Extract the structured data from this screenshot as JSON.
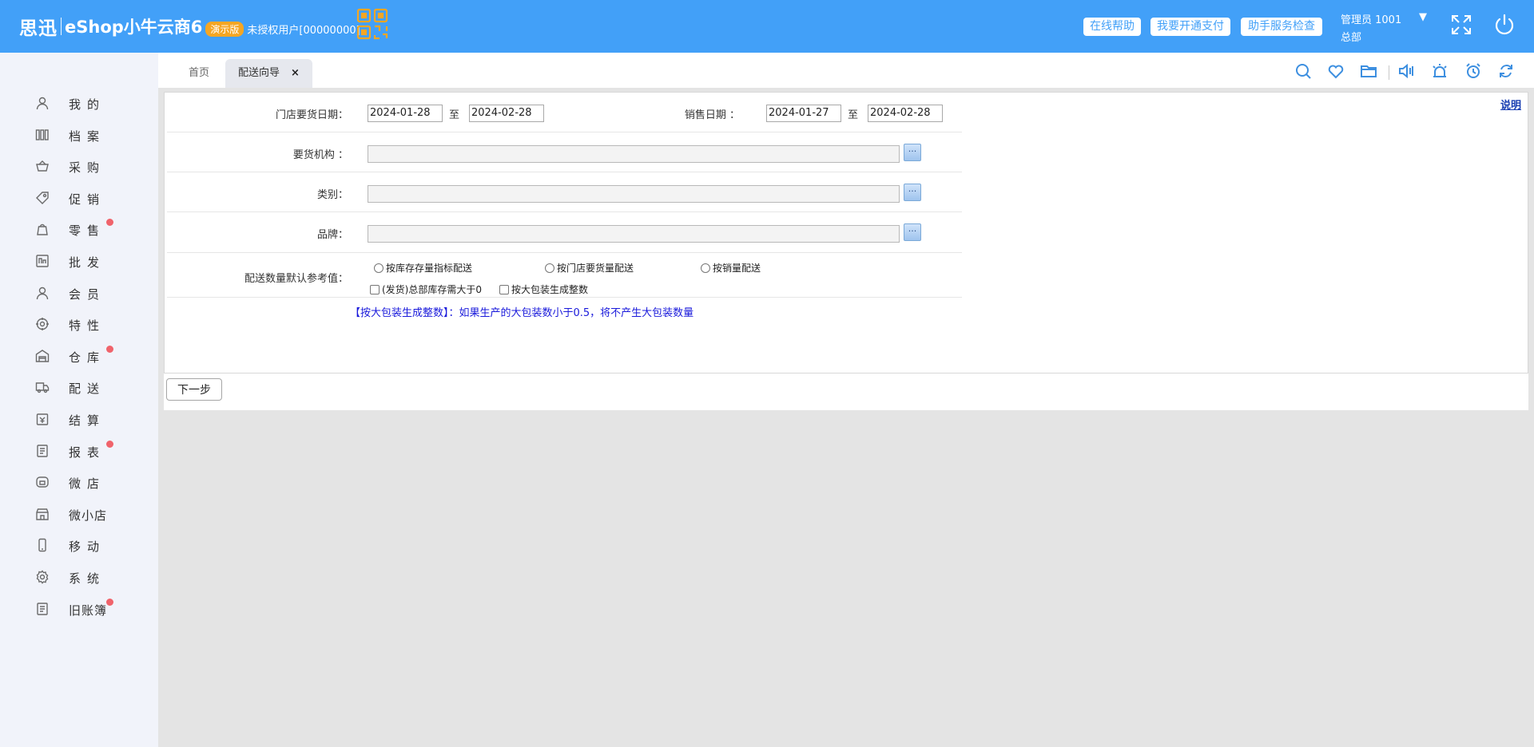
{
  "header": {
    "brand_cn": "思迅",
    "brand_name": "eShop小牛云商6",
    "demo_badge": "演示版",
    "unauthorized_user": "未授权用户[00000000]",
    "buttons": [
      "在线帮助",
      "我要开通支付",
      "助手服务检查"
    ],
    "user_name": "管理员 1001",
    "user_org": "总部",
    "icons": [
      "qr-code-icon",
      "fullscreen-icon",
      "power-icon"
    ],
    "colors": {
      "header_bg": "#42a0f8",
      "accent": "#f5a623",
      "dot": "#f0636b"
    }
  },
  "sidebar": {
    "items": [
      {
        "label": "我的",
        "icon": "user-icon",
        "dot": false
      },
      {
        "label": "档案",
        "icon": "archive-icon",
        "dot": false
      },
      {
        "label": "采购",
        "icon": "basket-icon",
        "dot": false
      },
      {
        "label": "促销",
        "icon": "tag-icon",
        "dot": false
      },
      {
        "label": "零售",
        "icon": "bag-icon",
        "dot": true
      },
      {
        "label": "批发",
        "icon": "wholesale-icon",
        "dot": false
      },
      {
        "label": "会员",
        "icon": "member-icon",
        "dot": false
      },
      {
        "label": "特性",
        "icon": "feature-icon",
        "dot": false
      },
      {
        "label": "仓库",
        "icon": "warehouse-icon",
        "dot": true
      },
      {
        "label": "配送",
        "icon": "truck-icon",
        "dot": false
      },
      {
        "label": "结算",
        "icon": "settlement-icon",
        "dot": false
      },
      {
        "label": "报表",
        "icon": "report-icon",
        "dot": true
      },
      {
        "label": "微店",
        "icon": "microstore-icon",
        "dot": false
      },
      {
        "label": "微小店",
        "icon": "shop-icon",
        "dot": false
      },
      {
        "label": "移动",
        "icon": "mobile-icon",
        "dot": false
      },
      {
        "label": "系统",
        "icon": "settings-icon",
        "dot": false
      },
      {
        "label": "旧账簿",
        "icon": "ledger-icon",
        "dot": true
      }
    ]
  },
  "tabs": {
    "home": "首页",
    "active": "配送向导",
    "close": "×",
    "tools": [
      "search-icon",
      "heart-icon",
      "folder-icon",
      "speaker-icon",
      "alarm-light-icon",
      "alarm-clock-icon",
      "refresh-icon"
    ]
  },
  "form": {
    "help_link": "说明",
    "store_date_label": "门店要货日期：",
    "store_date_from": "2024-01-28",
    "store_date_to": "2024-02-28",
    "to_word": "至",
    "sales_date_label": "销售日期 ：",
    "sales_date_from": "2024-01-27",
    "sales_date_to": "2024-02-28",
    "org_label": "要货机构 ：",
    "category_label": "类别：",
    "brand_label": "品牌：",
    "picker": "···",
    "qty_label": "配送数量默认参考值：",
    "radio_options": [
      "按库存存量指标配送",
      "按门店要货量配送",
      "按销量配送"
    ],
    "check_options": [
      "(发货)总部库存需大于0",
      "按大包装生成整数"
    ],
    "note": "【按大包装生成整数】：如果生产的大包装数小于0.5，将不产生大包装数量",
    "next_button": "下一步"
  }
}
